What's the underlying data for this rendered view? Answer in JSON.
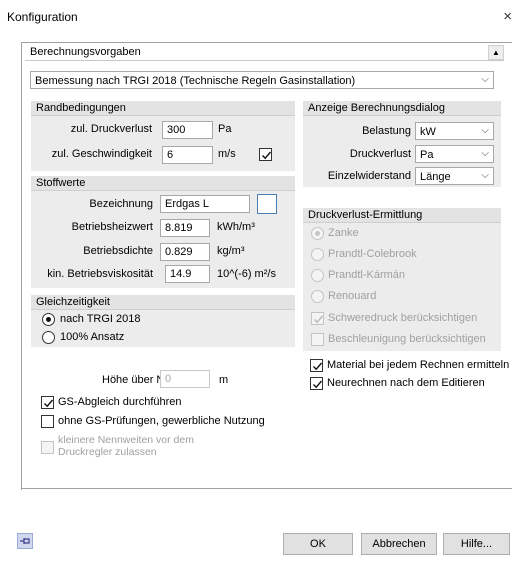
{
  "window": {
    "title": "Konfiguration",
    "close_glyph": "×"
  },
  "panel": {
    "title": "Berechnungsvorgaben"
  },
  "standard_select": {
    "value": "Bemessung nach TRGI 2018 (Technische Regeln Gasinstallation)"
  },
  "randbedingungen": {
    "title": "Randbedingungen",
    "druckverlust_label": "zul. Druckverlust",
    "druckverlust_value": "300",
    "druckverlust_unit": "Pa",
    "geschwindigkeit_label": "zul. Geschwindigkeit",
    "geschwindigkeit_value": "6",
    "geschwindigkeit_unit": "m/s",
    "geschwindigkeit_checked": true
  },
  "stoffwerte": {
    "title": "Stoffwerte",
    "bezeichnung_label": "Bezeichnung",
    "bezeichnung_value": "Erdgas L",
    "heizwert_label": "Betriebsheizwert",
    "heizwert_value": "8.819",
    "heizwert_unit": "kWh/m³",
    "dichte_label": "Betriebsdichte",
    "dichte_value": "0.829",
    "dichte_unit": "kg/m³",
    "viskositaet_label": "kin. Betriebsviskosität",
    "viskositaet_value": "14.9",
    "viskositaet_unit": "10^(-6) m²/s"
  },
  "gleichzeitigkeit": {
    "title": "Gleichzeitigkeit",
    "option1": "nach TRGI 2018",
    "option2": "100% Ansatz",
    "selected": "option1"
  },
  "hoehe": {
    "label": "Höhe über NN",
    "value": "0",
    "unit": "m"
  },
  "left_checks": {
    "gs_abgleich": "GS-Abgleich durchführen",
    "gs_abgleich_checked": true,
    "ohne_gs": "ohne GS-Prüfungen, gewerbliche Nutzung",
    "ohne_gs_checked": false,
    "kleinere_nw": "kleinere Nennweiten vor dem Druckregler zulassen",
    "kleinere_nw_checked": false
  },
  "anzeige": {
    "title": "Anzeige Berechnungsdialog",
    "belastung_label": "Belastung",
    "belastung_value": "kW",
    "druckverlust_label": "Druckverlust",
    "druckverlust_value": "Pa",
    "einzelwiderstand_label": "Einzelwiderstand",
    "einzelwiderstand_value": "Länge"
  },
  "druckverlust_ermittlung": {
    "title": "Druckverlust-Ermittlung",
    "options": [
      "Zanke",
      "Prandtl-Colebrook",
      "Prandtl-Kármán",
      "Renouard"
    ],
    "selected": "Zanke",
    "schweredruck": "Schweredruck berücksichtigen",
    "schweredruck_checked": true,
    "beschleunigung": "Beschleunigung berücksichtigen",
    "beschleunigung_checked": false
  },
  "right_checks": {
    "material": "Material bei jedem Rechnen ermitteln",
    "material_checked": true,
    "neurechnen": "Neurechnen nach dem Editieren",
    "neurechnen_checked": true
  },
  "buttons": {
    "ok": "OK",
    "abbrechen": "Abbrechen",
    "hilfe": "Hilfe..."
  },
  "icons": {
    "pin": "pin-icon",
    "dropdown": "chevron-down-icon",
    "check": "checkmark-icon"
  },
  "colors": {
    "accent": "#4a7fb5",
    "group_bg": "#ececec",
    "disabled_text": "#a0a0a0"
  }
}
